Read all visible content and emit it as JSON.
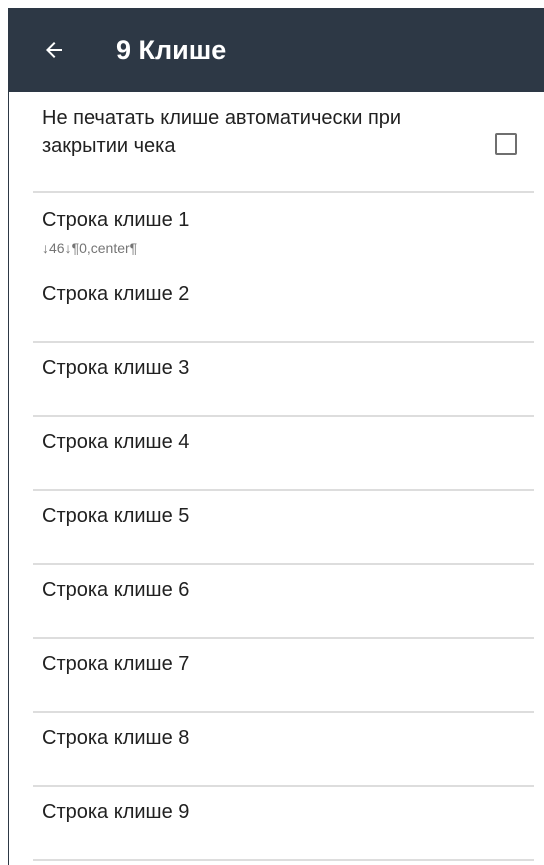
{
  "app_bar": {
    "title": "9 Клише",
    "back_icon": "arrow-left-icon",
    "background": "#2d3845"
  },
  "auto_print_pref": {
    "title": "Не печатать клише автоматически при закрытии чека",
    "checked": false
  },
  "cliche_lines": [
    {
      "title": "Строка клише 1",
      "summary": "↓46↓¶0,center¶"
    },
    {
      "title": "Строка клише 2",
      "summary": ""
    },
    {
      "title": "Строка клише 3",
      "summary": ""
    },
    {
      "title": "Строка клише 4",
      "summary": ""
    },
    {
      "title": "Строка клише 5",
      "summary": ""
    },
    {
      "title": "Строка клише 6",
      "summary": ""
    },
    {
      "title": "Строка клише 7",
      "summary": ""
    },
    {
      "title": "Строка клише 8",
      "summary": ""
    },
    {
      "title": "Строка клише 9",
      "summary": ""
    }
  ]
}
